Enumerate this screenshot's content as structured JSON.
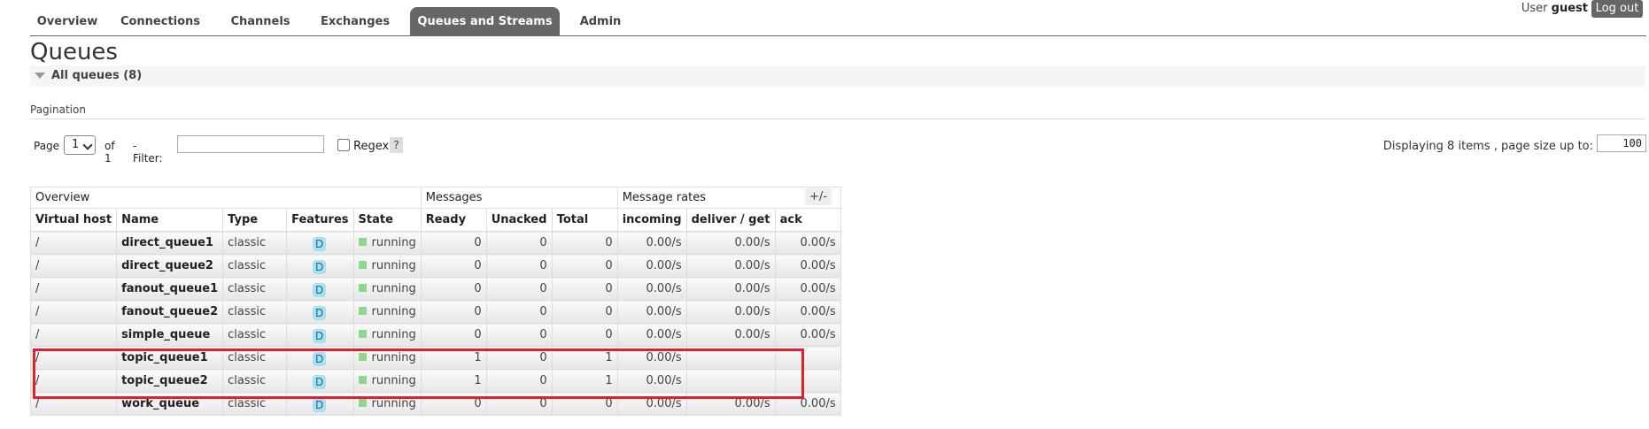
{
  "nav": {
    "tabs": [
      {
        "label": "Overview"
      },
      {
        "label": "Connections"
      },
      {
        "label": "Channels"
      },
      {
        "label": "Exchanges"
      },
      {
        "label": "Queues and Streams"
      },
      {
        "label": "Admin"
      }
    ],
    "active": "Queues and Streams",
    "user_prefix": "User",
    "user_name": "guest",
    "logout": "Log out"
  },
  "page_title": "Queues",
  "section": {
    "label": "All queues (8)"
  },
  "pagination": {
    "title": "Pagination",
    "page_label": "Page",
    "page_value": "1",
    "of_label": "of 1",
    "filter_label": "- Filter:",
    "filter_value": "",
    "regex_label": "Regex",
    "help": "?",
    "display_info": "Displaying 8 items , page size up to:",
    "page_size": "100"
  },
  "table": {
    "groups": [
      "Overview",
      "Messages",
      "Message rates"
    ],
    "toggle": "+/-",
    "columns": [
      "Virtual host",
      "Name",
      "Type",
      "Features",
      "State",
      "Ready",
      "Unacked",
      "Total",
      "incoming",
      "deliver / get",
      "ack"
    ],
    "rows": [
      {
        "vhost": "/",
        "name": "direct_queue1",
        "type": "classic",
        "feature": "D",
        "state": "running",
        "ready": "0",
        "unacked": "0",
        "total": "0",
        "incoming": "0.00/s",
        "deliver": "0.00/s",
        "ack": "0.00/s"
      },
      {
        "vhost": "/",
        "name": "direct_queue2",
        "type": "classic",
        "feature": "D",
        "state": "running",
        "ready": "0",
        "unacked": "0",
        "total": "0",
        "incoming": "0.00/s",
        "deliver": "0.00/s",
        "ack": "0.00/s"
      },
      {
        "vhost": "/",
        "name": "fanout_queue1",
        "type": "classic",
        "feature": "D",
        "state": "running",
        "ready": "0",
        "unacked": "0",
        "total": "0",
        "incoming": "0.00/s",
        "deliver": "0.00/s",
        "ack": "0.00/s"
      },
      {
        "vhost": "/",
        "name": "fanout_queue2",
        "type": "classic",
        "feature": "D",
        "state": "running",
        "ready": "0",
        "unacked": "0",
        "total": "0",
        "incoming": "0.00/s",
        "deliver": "0.00/s",
        "ack": "0.00/s"
      },
      {
        "vhost": "/",
        "name": "simple_queue",
        "type": "classic",
        "feature": "D",
        "state": "running",
        "ready": "0",
        "unacked": "0",
        "total": "0",
        "incoming": "0.00/s",
        "deliver": "0.00/s",
        "ack": "0.00/s"
      },
      {
        "vhost": "/",
        "name": "topic_queue1",
        "type": "classic",
        "feature": "D",
        "state": "running",
        "ready": "1",
        "unacked": "0",
        "total": "1",
        "incoming": "0.00/s",
        "deliver": "",
        "ack": ""
      },
      {
        "vhost": "/",
        "name": "topic_queue2",
        "type": "classic",
        "feature": "D",
        "state": "running",
        "ready": "1",
        "unacked": "0",
        "total": "1",
        "incoming": "0.00/s",
        "deliver": "",
        "ack": ""
      },
      {
        "vhost": "/",
        "name": "work_queue",
        "type": "classic",
        "feature": "D",
        "state": "running",
        "ready": "0",
        "unacked": "0",
        "total": "0",
        "incoming": "0.00/s",
        "deliver": "0.00/s",
        "ack": "0.00/s"
      }
    ]
  },
  "colors": {
    "accent": "#666666",
    "highlight": "#e02030",
    "running": "#8fd68f",
    "feature_badge": "#a8dff1"
  }
}
